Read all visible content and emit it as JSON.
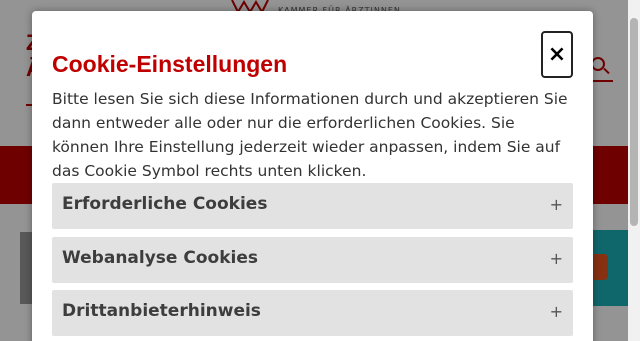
{
  "modal": {
    "title": "Cookie-Einstellungen",
    "close_label": "×",
    "intro": "Bitte lesen Sie sich diese Informationen durch und akzeptieren Sie dann entweder alle oder nur die erforderlichen Cookies. Sie können Ihre Einstellung jederzeit wieder anpassen, indem Sie auf das Cookie Symbol rechts unten klicken.",
    "sections": [
      {
        "label": "Erforderliche Cookies",
        "toggle": "+"
      },
      {
        "label": "Webanalyse Cookies",
        "toggle": "+"
      },
      {
        "label": "Drittanbieterhinweis",
        "toggle": "+"
      }
    ]
  },
  "background": {
    "logo_text": "KAMMER FÜR ÄRZTINNEN",
    "left_glyph": "Z\nÄ"
  },
  "colors": {
    "brand_red": "#c00000",
    "accordion_bg": "#e2e2e2",
    "teal": "#1ab2b8",
    "orange": "#e8531f"
  }
}
